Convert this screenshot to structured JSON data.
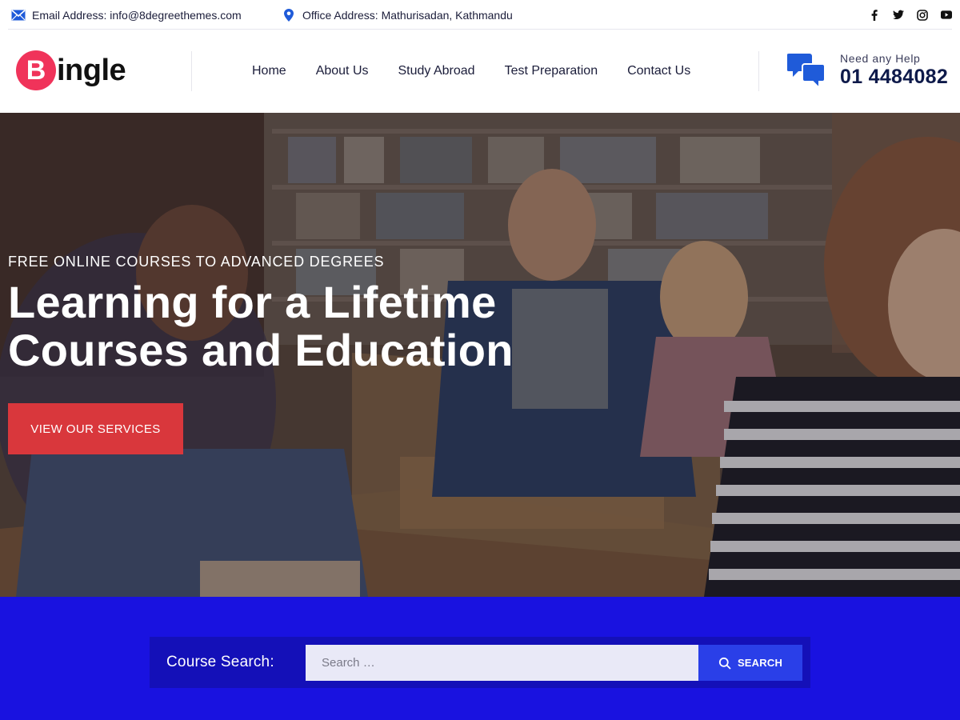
{
  "topbar": {
    "email_label": "Email Address: info@8degreethemes.com",
    "office_label": "Office Address: Mathurisadan, Kathmandu",
    "socials": [
      "facebook-icon",
      "twitter-icon",
      "instagram-icon",
      "youtube-icon"
    ]
  },
  "header": {
    "logo_letter": "B",
    "logo_text": "ingle",
    "nav": [
      "Home",
      "About Us",
      "Study Abroad",
      "Test Preparation",
      "Contact Us"
    ],
    "help_label": "Need any Help",
    "help_phone": "01 4484082"
  },
  "hero": {
    "kicker": "FREE ONLINE COURSES TO ADVANCED DEGREES",
    "title_line1": "Learning for a Lifetime",
    "title_line2": "Courses and Education",
    "cta_label": "VIEW OUR SERVICES"
  },
  "search": {
    "label": "Course Search:",
    "placeholder": "Search …",
    "button_label": "SEARCH"
  },
  "colors": {
    "accent_red": "#d9373c",
    "logo_pink": "#f0335a",
    "search_bg": "#1912e0",
    "search_button": "#2a3fe8",
    "icon_blue": "#1f5bd9"
  }
}
